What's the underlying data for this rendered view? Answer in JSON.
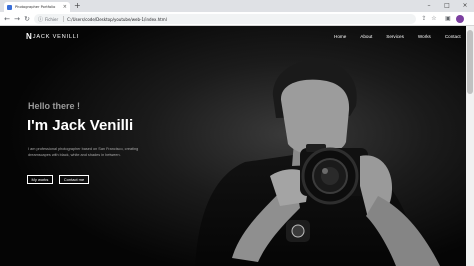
{
  "browser": {
    "tab_title": "Photographer Portfolio",
    "tab_close": "×",
    "new_tab": "+",
    "address_label": "Fichier",
    "address_url": "C:/Users/code/Desktop/youtube/web-1/index.html",
    "window_controls": [
      "–",
      "□",
      "×"
    ]
  },
  "site": {
    "logo_mark": "N",
    "logo_text": "JACK VENILLI",
    "nav": [
      "Home",
      "About",
      "Services",
      "Works",
      "Contact"
    ]
  },
  "hero": {
    "greeting": "Hello there !",
    "headline": "I'm Jack Venilli",
    "bio": "I am professional photographer based on San Francisco, creating dreamscapes with black, white and shades in between.",
    "buttons": [
      "My works",
      "Contact me"
    ]
  }
}
